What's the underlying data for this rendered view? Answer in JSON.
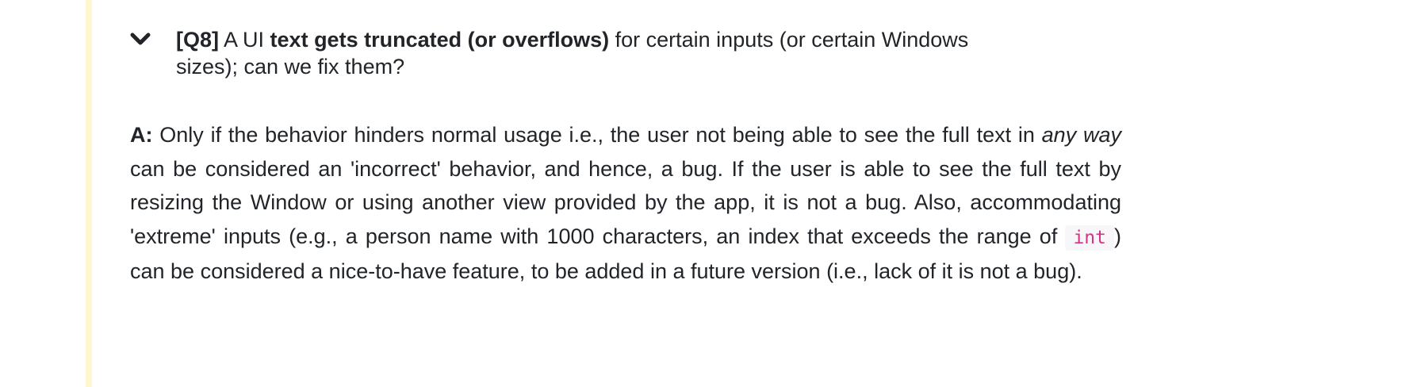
{
  "question": {
    "tag": "[Q8]",
    "text_1": " A UI ",
    "bold": "text gets truncated (or overflows)",
    "text_2": " for certain inputs (or certain Windows sizes); can we fix them?",
    "toggle_icon": "chevron-down"
  },
  "answer": {
    "label": "A:",
    "part_1": " Only if the behavior hinders normal usage i.e., the user not being able to see the full text in ",
    "emphasis": "any way",
    "part_2": " can be considered an 'incorrect' behavior, and hence, a bug. If the user is able to see the full text by resizing the Window or using another view provided by the app, it is not a bug. Also, accommodating 'extreme' inputs (e.g., a person name with 1000 characters, an index that exceeds the range of ",
    "code": "int",
    "part_3": ") can be considered a nice-to-have feature, to be added in a future version (i.e., lack of it is not a bug)."
  },
  "colors": {
    "accent_bar": "#fdf6cf",
    "text": "#212529",
    "code_text": "#d63384",
    "code_bg": "#f7f7f9"
  }
}
